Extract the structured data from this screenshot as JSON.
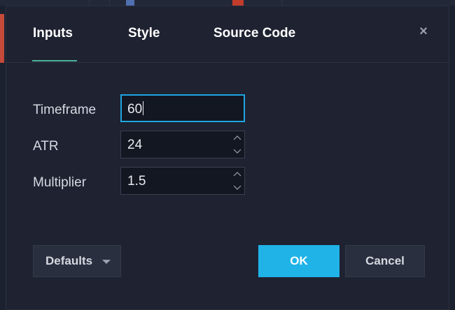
{
  "tabs": [
    {
      "label": "Inputs",
      "active": true
    },
    {
      "label": "Style",
      "active": false
    },
    {
      "label": "Source Code",
      "active": false
    }
  ],
  "close_icon": "close-icon",
  "close_glyph": "×",
  "inputs": [
    {
      "label": "Timeframe",
      "value": "60",
      "focused": true,
      "has_stepper": false
    },
    {
      "label": "ATR",
      "value": "24",
      "focused": false,
      "has_stepper": true
    },
    {
      "label": "Multiplier",
      "value": "1.5",
      "focused": false,
      "has_stepper": true
    }
  ],
  "buttons": {
    "defaults": "Defaults",
    "ok": "OK",
    "cancel": "Cancel"
  },
  "colors": {
    "accent": "#1fb3e8",
    "tab_underline": "#4fb29a",
    "dialog_bg": "#1e2231",
    "focus_border": "#1fa6e0"
  }
}
